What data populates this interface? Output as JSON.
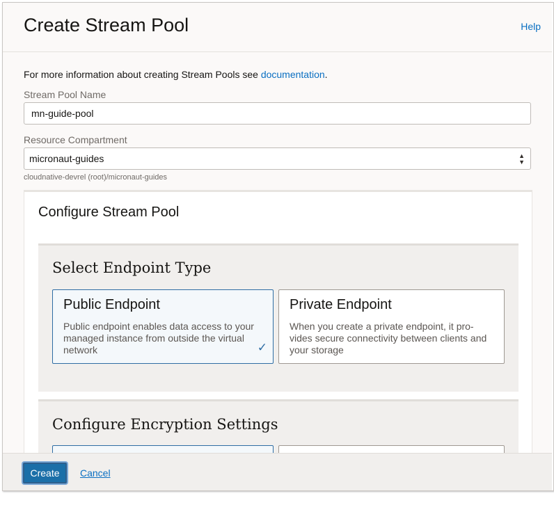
{
  "dialog": {
    "title": "Create Stream Pool",
    "help_label": "Help"
  },
  "info": {
    "text": "For more information about creating Stream Pools see ",
    "link_label": "documentation",
    "suffix": "."
  },
  "form": {
    "name_label": "Stream Pool Name",
    "name_value": "mn-guide-pool",
    "compartment_label": "Resource Compartment",
    "compartment_value": "micronaut-guides",
    "compartment_path": "cloudnative-devrel (root)/micronaut-guides"
  },
  "configure": {
    "title": "Configure Stream Pool",
    "endpoint_section": {
      "title": "Select Endpoint Type",
      "options": [
        {
          "title": "Public Endpoint",
          "description": "Public endpoint enables data access to your managed instance from outside the virtual network",
          "selected": true
        },
        {
          "title": "Private Endpoint",
          "description": "When you create a private endpoint, it pro-vides secure connectivity between clients and your storage",
          "selected": false
        }
      ]
    },
    "encryption_section": {
      "title": "Configure Encryption Settings"
    }
  },
  "footer": {
    "create_label": "Create",
    "cancel_label": "Cancel"
  },
  "icons": {
    "check": "check-icon",
    "select_arrows": "sort-arrows-icon"
  },
  "colors": {
    "accent": "#1b6fa8",
    "link": "#0a6fc2",
    "selected_border": "#2e6da4"
  }
}
